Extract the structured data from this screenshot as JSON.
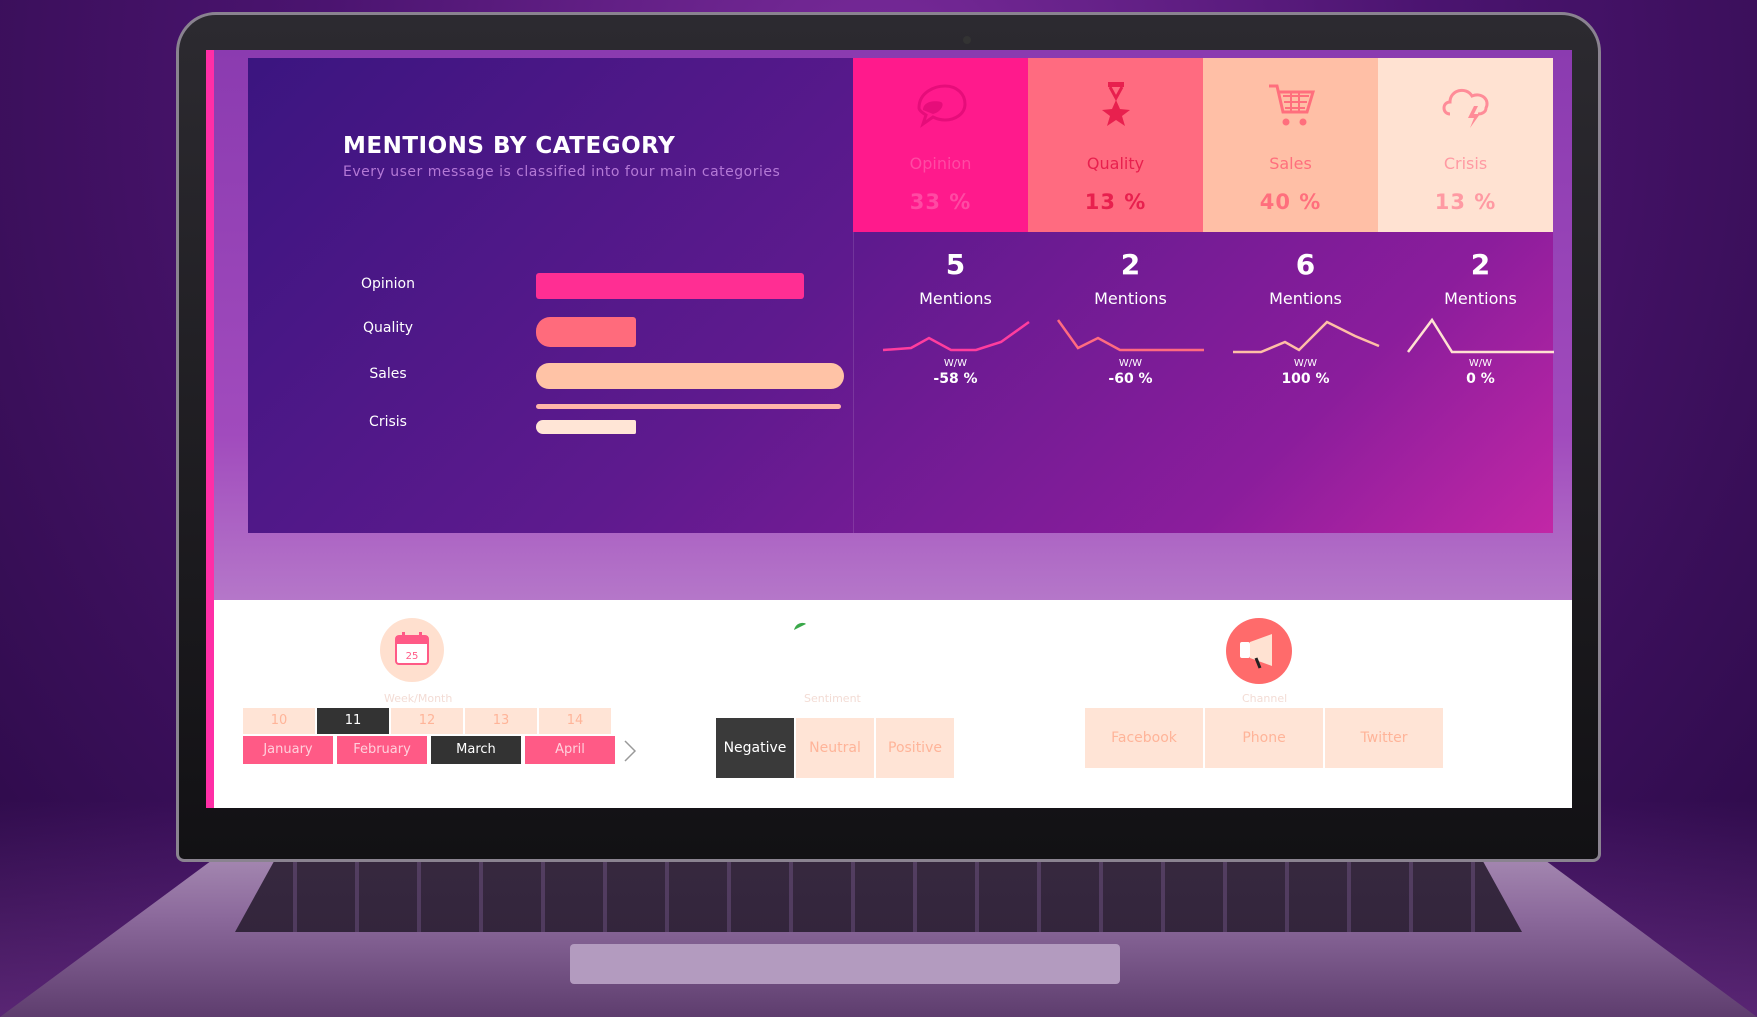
{
  "header": {
    "title": "MENTIONS BY CATEGORY",
    "subtitle": "Every user message is classified into four main categories"
  },
  "categories_chart": {
    "type": "bar",
    "categories": [
      "Opinion",
      "Quality",
      "Sales",
      "Crisis"
    ],
    "colors": [
      "#ff2e93",
      "#ff6b7c",
      "#ffc3a6",
      "#ffe5d6"
    ]
  },
  "tiles": [
    {
      "label": "Opinion",
      "value": "33 %",
      "icon": "speech-bubble-icon",
      "bg": "#ff1a8c",
      "fg": "#ff4aa3"
    },
    {
      "label": "Quality",
      "value": "13 %",
      "icon": "award-medal-icon",
      "bg": "#ff6b80",
      "fg": "#e8204e"
    },
    {
      "label": "Sales",
      "value": "40 %",
      "icon": "shopping-cart-icon",
      "bg": "#ffbfa6",
      "fg": "#ff6f7d"
    },
    {
      "label": "Crisis",
      "value": "13 %",
      "icon": "storm-cloud-icon",
      "bg": "#ffe2d2",
      "fg": "#ff9aa3"
    }
  ],
  "sparks": [
    {
      "count": "5",
      "label": "Mentions",
      "ww": "W/W",
      "pct": "-58 %"
    },
    {
      "count": "2",
      "label": "Mentions",
      "ww": "W/W",
      "pct": "-60 %"
    },
    {
      "count": "6",
      "label": "Mentions",
      "ww": "W/W",
      "pct": "100 %"
    },
    {
      "count": "2",
      "label": "Mentions",
      "ww": "W/W",
      "pct": "0 %"
    }
  ],
  "date_slicer": {
    "title": "Week/Month",
    "weeks": [
      "10",
      "11",
      "12",
      "13",
      "14"
    ],
    "selected_week": "11",
    "months": [
      "January",
      "February",
      "March",
      "April"
    ],
    "selected_month": "March",
    "next_icon": "chevron-right-icon"
  },
  "sentiment_slicer": {
    "title": "Sentiment",
    "options": [
      "Negative",
      "Neutral",
      "Positive"
    ],
    "selected": "Negative"
  },
  "channel_slicer": {
    "title": "Channel",
    "options": [
      "Facebook",
      "Phone",
      "Twitter"
    ],
    "icon": "megaphone-icon"
  }
}
